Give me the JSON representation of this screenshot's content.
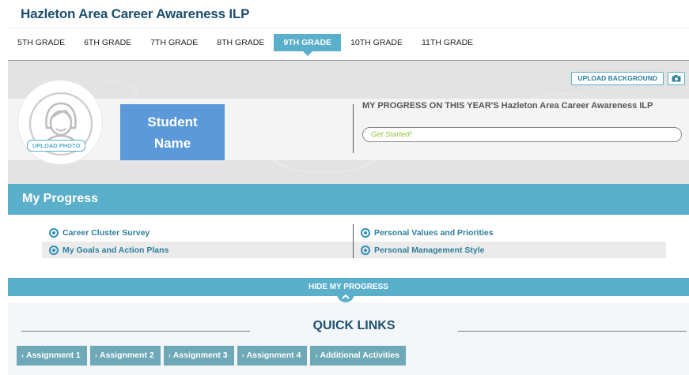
{
  "app": {
    "title": "Hazleton Area Career Awareness ILP"
  },
  "tabs": [
    {
      "label": "5TH GRADE",
      "active": false
    },
    {
      "label": "6TH GRADE",
      "active": false
    },
    {
      "label": "7TH GRADE",
      "active": false
    },
    {
      "label": "8TH GRADE",
      "active": false
    },
    {
      "label": "9TH GRADE",
      "active": true
    },
    {
      "label": "10TH GRADE",
      "active": false
    },
    {
      "label": "11TH GRADE",
      "active": false
    }
  ],
  "profile": {
    "upload_background_label": "UPLOAD BACKGROUND",
    "camera_icon": "camera-icon",
    "upload_photo_label": "UPLOAD PHOTO",
    "avatar_icon": "person-icon",
    "student_name_line1": "Student",
    "student_name_line2": "Name",
    "progress_heading": "MY PROGRESS ON THIS YEAR'S Hazleton Area Career Awareness ILP",
    "progress_status": "Get Started!"
  },
  "my_progress": {
    "title": "My Progress",
    "items": [
      {
        "label": "Career Cluster Survey"
      },
      {
        "label": "Personal Values and Priorities"
      },
      {
        "label": "My Goals and Action Plans"
      },
      {
        "label": "Personal Management Style"
      }
    ],
    "hide_label": "HIDE MY PROGRESS"
  },
  "quick_links": {
    "title": "QUICK LINKS",
    "buttons": [
      {
        "label": "Assignment 1"
      },
      {
        "label": "Assignment 2"
      },
      {
        "label": "Assignment 3"
      },
      {
        "label": "Assignment 4"
      },
      {
        "label": "Additional Activities"
      }
    ]
  },
  "colors": {
    "accent": "#5aafcb",
    "title": "#1d4f6e",
    "name_box": "#5b99d8",
    "status_green": "#8dc63f",
    "quick_link_button": "#6fa9b8"
  }
}
